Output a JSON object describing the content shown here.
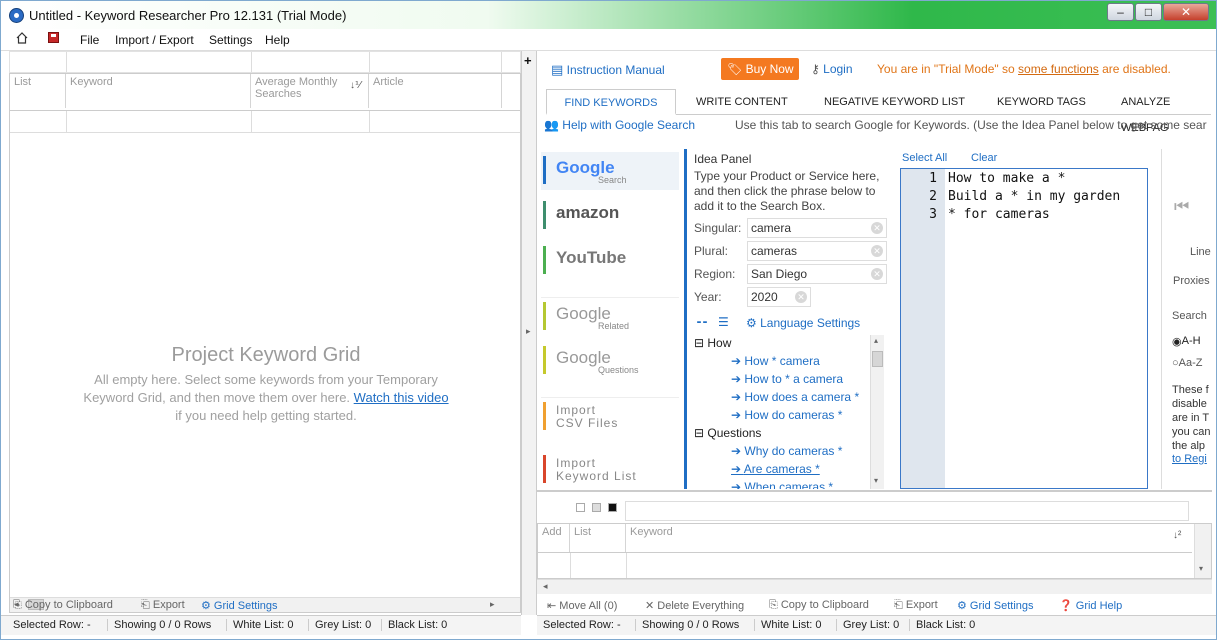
{
  "window": {
    "title": "Untitled - Keyword Researcher Pro 12.131 (Trial Mode)",
    "minimize": "–",
    "maximize": "□",
    "close": "✕"
  },
  "menu": {
    "file": "File",
    "import_export": "Import / Export",
    "settings": "Settings",
    "help": "Help"
  },
  "left_grid": {
    "headers": [
      "List",
      "Keyword",
      "Average Monthly Searches",
      "Article"
    ],
    "title": "Project Keyword Grid",
    "text_before": "All empty here. Select some keywords from your Temporary Keyword Grid, and then move them over here.",
    "link": "Watch this video",
    "text_after": "if you need help getting started.",
    "actions": [
      "Copy to Clipboard",
      "Export",
      "Grid Settings"
    ],
    "status": [
      "Selected Row: -",
      "Showing 0 / 0 Rows",
      "White List: 0",
      "Grey List: 0",
      "Black List: 0"
    ]
  },
  "top": {
    "instruction_manual": "Instruction Manual",
    "buy_now": "Buy Now",
    "login": "Login",
    "trial_prefix": "You are in \"Trial Mode\" so",
    "trial_link": "some functions",
    "trial_suffix": "are disabled."
  },
  "tabs": [
    "FIND KEYWORDS",
    "WRITE CONTENT",
    "NEGATIVE KEYWORD LIST",
    "KEYWORD TAGS",
    "ANALYZE WEBPAG"
  ],
  "subline": {
    "help": "Help with Google Search",
    "note": "Use this tab to search Google for Keywords. (Use the Idea Panel below to get some sear"
  },
  "sources": [
    {
      "name": "Google",
      "sub": "Search"
    },
    {
      "name": "amazon",
      "sub": ""
    },
    {
      "name": "YouTube",
      "sub": ""
    },
    {
      "name": "Google",
      "sub": "Related"
    },
    {
      "name": "Google",
      "sub": "Questions"
    },
    {
      "name": "Import CSV Files",
      "sub": ""
    },
    {
      "name": "Import Keyword List",
      "sub": ""
    }
  ],
  "idea": {
    "title": "Idea Panel",
    "desc": "Type your Product or Service here, and then click the phrase below to add it to the Search Box.",
    "singular_label": "Singular:",
    "singular": "camera",
    "plural_label": "Plural:",
    "plural": "cameras",
    "region_label": "Region:",
    "region": "San Diego",
    "year_label": "Year:",
    "year": "2020",
    "language": "Language Settings",
    "tree": {
      "how": "How",
      "how_items": [
        "How * camera",
        "How to * a camera",
        "How does a camera *",
        "How do cameras *"
      ],
      "questions": "Questions",
      "question_items": [
        "Why do cameras *",
        "Are cameras *",
        "When cameras *"
      ]
    }
  },
  "editor": {
    "select_all": "Select All",
    "clear": "Clear",
    "lines": [
      "How to make a *",
      "Build a * in my garden",
      "* for cameras"
    ]
  },
  "far_right": {
    "line": "Line",
    "proxies": "Proxies",
    "search": "Search",
    "opt1": "A-H",
    "opt2": "Aa-Z",
    "note": "These f disable are in T you can the alp",
    "link": "to Regi"
  },
  "temp_grid": {
    "headers": [
      "Add",
      "List",
      "Keyword"
    ],
    "actions": [
      "Move All (0)",
      "Delete Everything",
      "Copy to Clipboard",
      "Export",
      "Grid Settings",
      "Grid Help"
    ],
    "status": [
      "Selected Row: -",
      "Showing 0 / 0 Rows",
      "White List: 0",
      "Grey List: 0",
      "Black List: 0"
    ]
  }
}
